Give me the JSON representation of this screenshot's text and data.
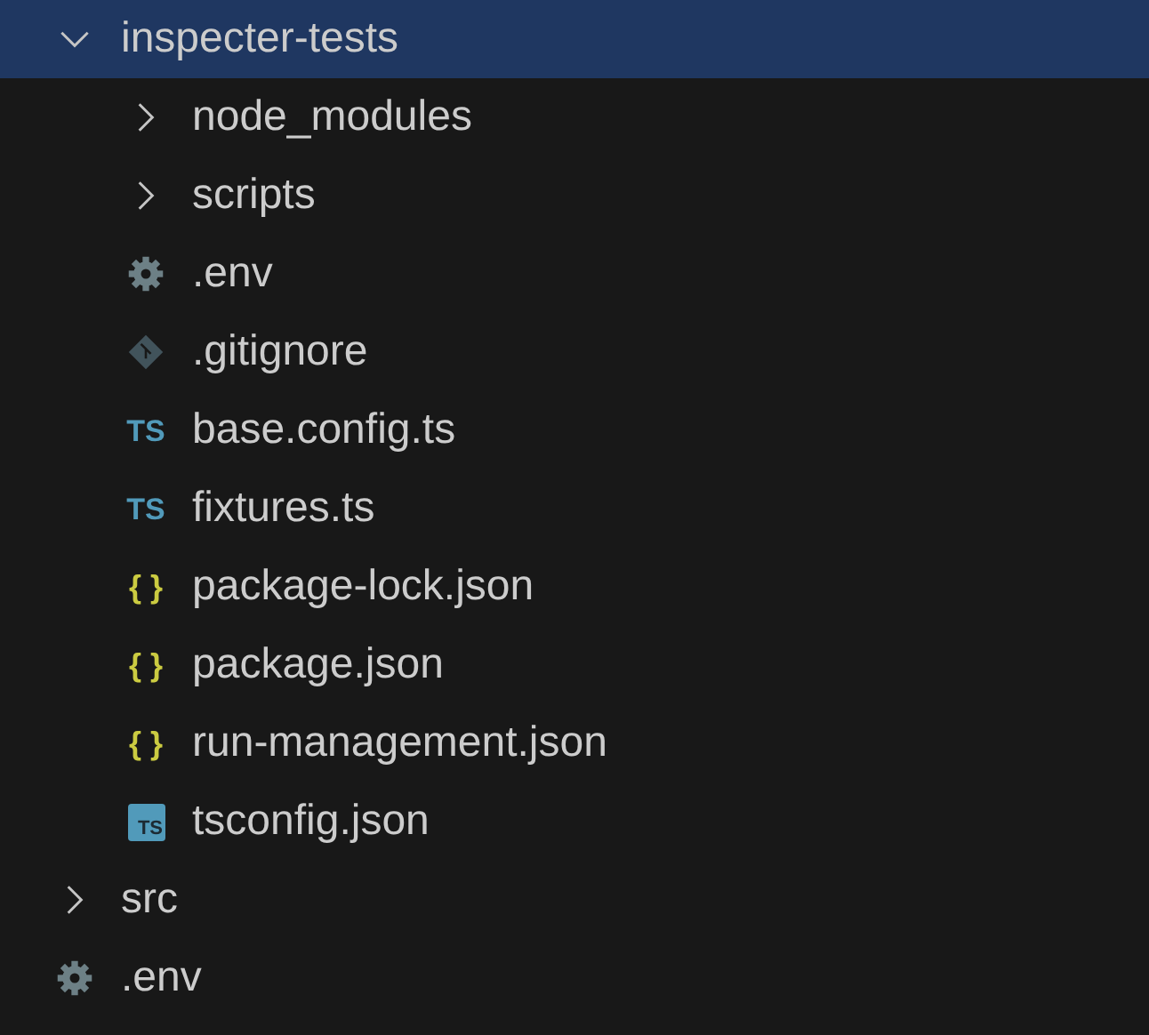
{
  "explorer": {
    "items": [
      {
        "kind": "folder",
        "label": "inspecter-tests",
        "expanded": true,
        "selected": true,
        "children": [
          {
            "kind": "folder",
            "label": "node_modules",
            "expanded": false,
            "selected": false
          },
          {
            "kind": "folder",
            "label": "scripts",
            "expanded": false,
            "selected": false
          },
          {
            "kind": "settings",
            "label": ".env",
            "selected": false
          },
          {
            "kind": "git",
            "label": ".gitignore",
            "selected": false
          },
          {
            "kind": "ts",
            "badge": "TS",
            "label": "base.config.ts",
            "selected": false
          },
          {
            "kind": "ts",
            "badge": "TS",
            "label": "fixtures.ts",
            "selected": false
          },
          {
            "kind": "json",
            "badge": "{ }",
            "label": "package-lock.json",
            "selected": false
          },
          {
            "kind": "json",
            "badge": "{ }",
            "label": "package.json",
            "selected": false
          },
          {
            "kind": "json",
            "badge": "{ }",
            "label": "run-management.json",
            "selected": false
          },
          {
            "kind": "tsconfig",
            "badge": "TS",
            "label": "tsconfig.json",
            "selected": false
          }
        ]
      },
      {
        "kind": "folder",
        "label": "src",
        "expanded": false,
        "selected": false
      },
      {
        "kind": "settings",
        "label": ".env",
        "selected": false
      }
    ]
  }
}
